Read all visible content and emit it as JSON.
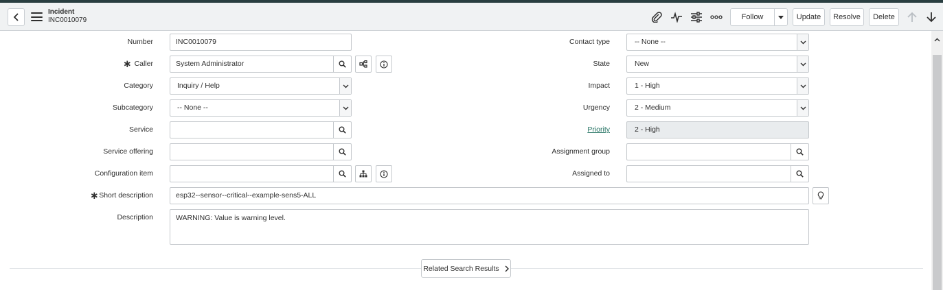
{
  "header": {
    "title": "Incident",
    "subtitle": "INC0010079",
    "follow_label": "Follow",
    "update_label": "Update",
    "resolve_label": "Resolve",
    "delete_label": "Delete"
  },
  "form": {
    "left": {
      "number_label": "Number",
      "number_value": "INC0010079",
      "caller_label": "Caller",
      "caller_value": "System Administrator",
      "category_label": "Category",
      "category_value": "Inquiry / Help",
      "subcategory_label": "Subcategory",
      "subcategory_value": "-- None --",
      "service_label": "Service",
      "service_value": "",
      "service_offering_label": "Service offering",
      "service_offering_value": "",
      "config_item_label": "Configuration item",
      "config_item_value": ""
    },
    "right": {
      "contact_type_label": "Contact type",
      "contact_type_value": "-- None --",
      "state_label": "State",
      "state_value": "New",
      "impact_label": "Impact",
      "impact_value": "1 - High",
      "urgency_label": "Urgency",
      "urgency_value": "2 - Medium",
      "priority_label": "Priority",
      "priority_value": "2 - High",
      "assignment_group_label": "Assignment group",
      "assignment_group_value": "",
      "assigned_to_label": "Assigned to",
      "assigned_to_value": ""
    },
    "short_description_label": "Short description",
    "short_description_value": "esp32--sensor--critical--example-sens5-ALL",
    "description_label": "Description",
    "description_value": "WARNING: Value is warning level.",
    "related_button_label": "Related Search Results"
  },
  "colors": {
    "topstrip": "#293e40",
    "header_bg": "#f0f2f3",
    "link": "#1f6f5f",
    "readonly_bg": "#e9ecee"
  },
  "icons": [
    "back-icon",
    "menu-icon",
    "attachment-icon",
    "activity-icon",
    "settings-icon",
    "more-icon",
    "caret-down-icon",
    "arrow-up-icon",
    "arrow-down-icon",
    "search-icon",
    "hierarchy-icon",
    "info-icon",
    "lightbulb-icon",
    "chevron-right-icon"
  ]
}
